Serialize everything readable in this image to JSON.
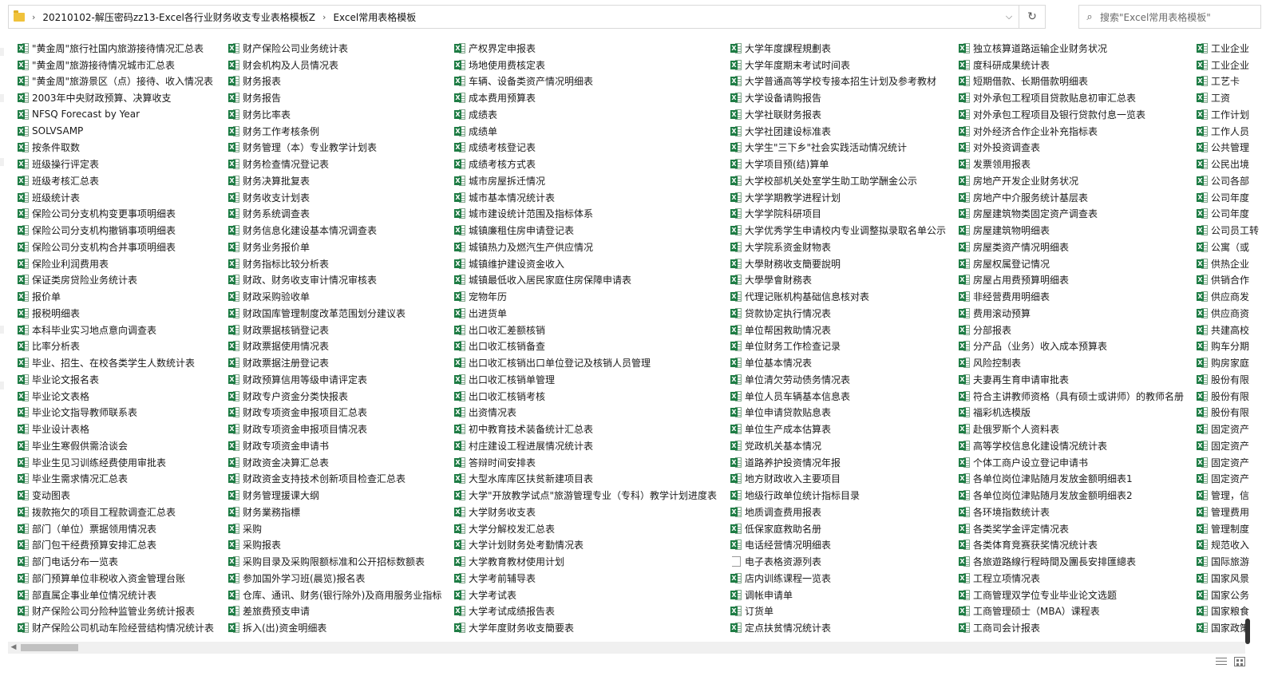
{
  "address": {
    "crumbs": [
      "20210102-解压密码zz13-Excel各行业财务收支专业表格模板Z",
      "Excel常用表格模板"
    ],
    "separator": "›"
  },
  "search": {
    "placeholder": "搜索\"Excel常用表格模板\""
  },
  "icons": {
    "folder": "folder-icon",
    "excel": "excel-file-icon",
    "doc": "document-file-icon",
    "refresh": "refresh-icon",
    "search": "search-icon",
    "dropdown": "chevron-down-icon"
  },
  "files": {
    "col1": [
      "\"黄金周\"旅行社国内旅游接待情况汇总表",
      "\"黄金周\"旅游接待情况城市汇总表",
      "\"黄金周\"旅游景区（点）接待、收入情况表",
      "2003年中央财政预算、决算收支",
      "NFSQ Forecast  by Year",
      "SOLVSAMP",
      "按条件取数",
      "班级操行评定表",
      "班级考核汇总表",
      "班级统计表",
      "保险公司分支机构变更事项明细表",
      "保险公司分支机构撤销事项明细表",
      "保险公司分支机构合并事项明细表",
      "保险业利润费用表",
      "保证类房贷险业务统计表",
      "报价单",
      "报税明细表",
      "本科毕业实习地点意向调查表",
      "比率分析表",
      "毕业、招生、在校各类学生人数统计表",
      "毕业论文报名表",
      "毕业论文表格",
      "毕业论文指导教师联系表",
      "毕业设计表格",
      "毕业生寒假供需洽谈会",
      "毕业生见习训练经费使用审批表",
      "毕业生需求情况汇总表",
      "变动图表",
      "拨款拖欠的项目工程款调查汇总表",
      "部门（单位）票据领用情况表",
      "部门包干经费预算安排汇总表",
      "部门电话分布一览表",
      "部门预算单位非税收入资金管理台账",
      "部直属企事业单位情况统计表",
      "财产保险公司分险种监管业务统计报表",
      "财产保险公司机动车险经营结构情况统计表"
    ],
    "col2": [
      "财产保险公司业务统计表",
      "财会机构及人员情况表",
      "财务报表",
      "财务报告",
      "财务比率表",
      "财务工作考核条例",
      "财务管理（本）专业教学计划表",
      "财务检查情况登记表",
      "财务决算批复表",
      "财务收支计划表",
      "财务系统调查表",
      "财务信息化建设基本情况调查表",
      "财务业务报价单",
      "财务指标比较分析表",
      "财政、财务收支审计情况审核表",
      "财政采购验收单",
      "财政国库管理制度改革范围划分建议表",
      "财政票据核销登记表",
      "财政票据使用情况表",
      "财政票据注册登记表",
      "财政预算信用等级申请评定表",
      "财政专户资金分类快报表",
      "财政专项资金申报项目汇总表",
      "财政专项资金申报项目情况表",
      "财政专项资金申请书",
      "财政资金决算汇总表",
      "财政资金支持技术创新项目检查汇总表",
      "财务管理援课大纲",
      "财务業務指標",
      "采购",
      "采购报表",
      "采购目录及采购限额标准和公开招标数额表",
      "参加国外学习班(晨览)报名表",
      "仓库、通讯、财务(银行除外)及商用服务业指标",
      "差旅费预支申请",
      "拆入(出)资金明细表"
    ],
    "col3": [
      "产权界定申报表",
      "场地使用费核定表",
      "车辆、设备类资产情况明细表",
      "成本费用预算表",
      "成绩表",
      "成绩单",
      "成绩考核登记表",
      "成绩考核方式表",
      "城市房屋拆迁情况",
      "城市基本情况统计表",
      "城市建设统计范围及指标体系",
      "城镇廉租住房申请登记表",
      "城镇热力及燃汽生产供应情况",
      "城镇维护建设资金收入",
      "城镇最低收入居民家庭住房保障申请表",
      "宠物年历",
      "出进货单",
      "出口收汇差额核销",
      "出口收汇核销备查",
      "出口收汇核销出口单位登记及核销人员管理",
      "出口收汇核销单管理",
      "出口收汇核销考核",
      "出资情况表",
      "初中教育技术装备统计汇总表",
      "村庄建设工程进展情况统计表",
      "答辩时间安排表",
      "大型水库库区扶贫新建项目表",
      "大学\"开放教学试点\"旅游管理专业（专科）教学计划进度表",
      "大学财务收支表",
      "大学分解校发汇总表",
      "大学计划财务处考勤情况表",
      "大学教育教材使用计划",
      "大学考前辅导表",
      "大学考试表",
      "大学考试成绩报告表",
      "大学年度财务收支簡要表"
    ],
    "col4": [
      "大学年度課程規劃表",
      "大学年度期末考试时间表",
      "大学普通高等学校专接本招生计划及参考教材",
      "大学设备请购报告",
      "大学社联财务报表",
      "大学社团建设标准表",
      "大学生\"三下乡\"社会实践活动情况统计",
      "大学项目预(结)算单",
      "大学校部机关处室学生助工助学酬金公示",
      "大学学期教学进程计划",
      "大学学院科研项目",
      "大学优秀学生申请校内专业调整拟录取名单公示",
      "大学院系资金财物表",
      "大學財務收支簡要說明",
      "大學學會財務表",
      "代理记账机构基础信息核对表",
      "贷款协定执行情况表",
      "单位帮困救助情况表",
      "单位财务工作检查记录",
      "单位基本情况表",
      "单位清欠劳动债务情况表",
      "单位人员车辆基本信息表",
      "单位申请贷款贴息表",
      "单位生产成本估算表",
      "党政机关基本情况",
      "道路养护投资情况年报",
      "地方财政收入主要项目",
      "地级行政单位统计指标目录",
      "地质调查费用报表",
      "低保家庭救助名册",
      "电话经营情况明细表",
      "电子表格资源列表",
      "店内训练课程一览表",
      "调帐申请单",
      "订货单",
      "定点扶贫情况统计表"
    ],
    "col5": [
      "独立核算道路运输企业财务状况",
      "度科研成果统计表",
      "短期借款、长期借款明细表",
      "对外承包工程项目贷款贴息初审汇总表",
      "对外承包工程项目及银行贷款付息一览表",
      "对外经济合作企业补充指标表",
      "对外投资调查表",
      "发票领用报表",
      "房地产开发企业财务状况",
      "房地产中介服务统计基层表",
      "房屋建筑物类固定资产调查表",
      "房屋建筑物明细表",
      "房屋类资产情况明细表",
      "房屋权属登记情况",
      "房屋占用费预算明细表",
      "非经营费用明细表",
      "费用滚动预算",
      "分部报表",
      "分产品（业务）收入成本预算表",
      "风险控制表",
      "夫妻再生育申请审批表",
      "符合主讲教师资格（具有硕士或讲师）的教师名册",
      "福彩机选模版",
      "赴俄罗斯个人资料表",
      "高等学校信息化建设情况统计表",
      "个体工商户设立登记申请书",
      "各单位岗位津贴随月发放金额明细表1",
      "各单位岗位津贴随月发放金额明细表2",
      "各环境指数统计表",
      "各类奖学金评定情况表",
      "各类体育竞赛获奖情况统计表",
      "各旅遊路線行程時間及團長安排匯總表",
      "工程立项情况表",
      "工商管理双学位专业毕业论文选题",
      "工商管理硕士（MBA）课程表",
      "工商司会计报表"
    ],
    "col6": [
      "工业企业",
      "工业企业",
      "工艺卡",
      "工资",
      "工作计划",
      "工作人员",
      "公共管理",
      "公民出境",
      "公司各部",
      "公司年度",
      "公司年度",
      "公司员工转",
      "公寓（或",
      "供热企业",
      "供销合作",
      "供应商发",
      "供应商资",
      "共建高校",
      "购车分期",
      "购房家庭",
      "股份有限",
      "股份有限",
      "股份有限",
      "固定资产",
      "固定资产",
      "固定资产",
      "固定资产",
      "管理，信",
      "管理费用",
      "管理制度",
      "规范收入",
      "国际旅游",
      "国家风景",
      "国家公务",
      "国家粮食",
      "国家政策"
    ]
  },
  "doc_items": [
    [
      "col4",
      31
    ]
  ]
}
